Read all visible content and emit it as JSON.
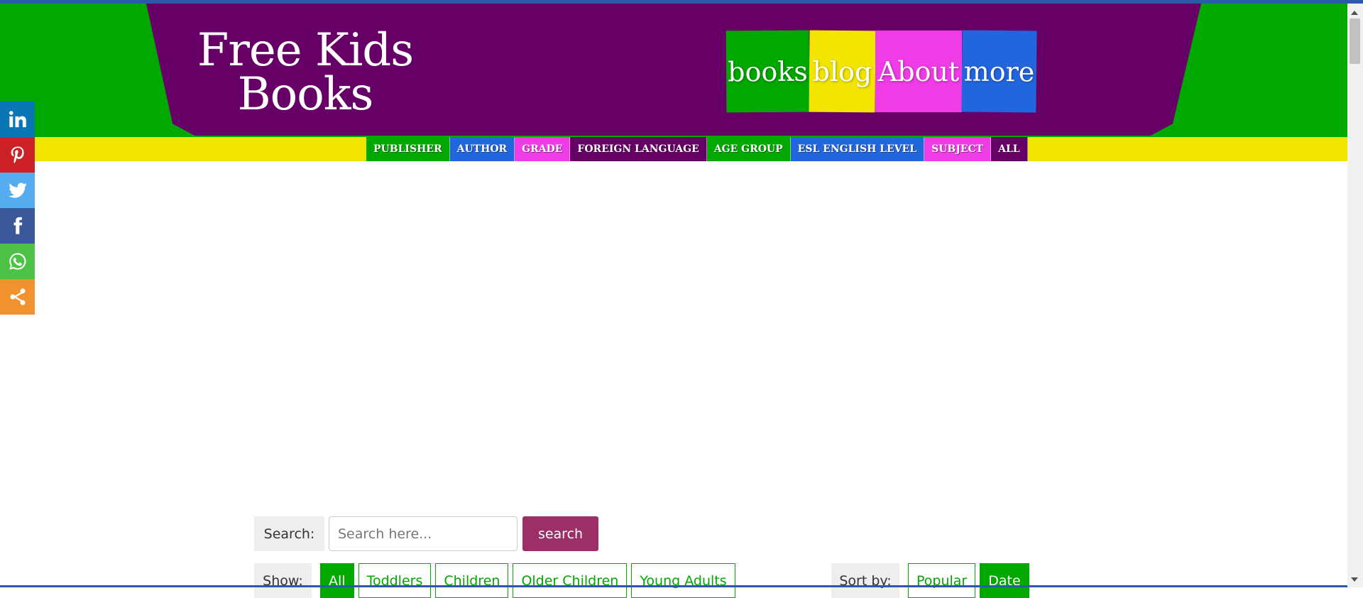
{
  "site": {
    "logo_line1": "Free Kids",
    "logo_line2": "Books"
  },
  "main_nav": [
    {
      "label": "books"
    },
    {
      "label": "blog"
    },
    {
      "label": "About"
    },
    {
      "label": "more"
    }
  ],
  "sub_nav": [
    {
      "label": "PUBLISHER"
    },
    {
      "label": "AUTHOR"
    },
    {
      "label": "GRADE"
    },
    {
      "label": "FOREIGN LANGUAGE"
    },
    {
      "label": "AGE GROUP"
    },
    {
      "label": "ESL ENGLISH LEVEL"
    },
    {
      "label": "SUBJECT"
    },
    {
      "label": "ALL"
    }
  ],
  "social": [
    {
      "icon": "linkedin-icon"
    },
    {
      "icon": "pinterest-icon"
    },
    {
      "icon": "twitter-icon"
    },
    {
      "icon": "facebook-icon"
    },
    {
      "icon": "whatsapp-icon"
    },
    {
      "icon": "share-icon"
    }
  ],
  "search": {
    "label": "Search:",
    "placeholder": "Search here...",
    "value": "",
    "button": "search"
  },
  "show": {
    "label": "Show:",
    "options": [
      "All",
      "Toddlers",
      "Children",
      "Older Children",
      "Young Adults"
    ],
    "selected": "All"
  },
  "sort": {
    "label": "Sort by:",
    "options": [
      "Popular",
      "Date"
    ],
    "selected": "Date"
  },
  "colors": {
    "green": "#00a800",
    "purple": "#660066",
    "yellow": "#f2e500",
    "pink": "#f03ce6",
    "blue": "#2266dd",
    "search_button": "#9c2f66"
  }
}
